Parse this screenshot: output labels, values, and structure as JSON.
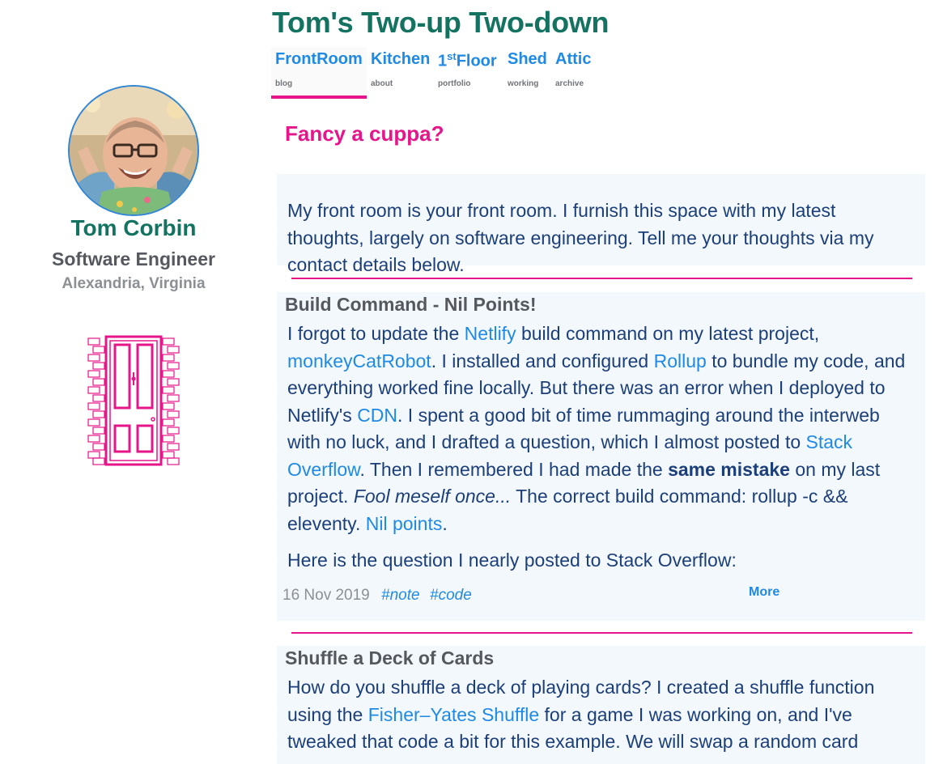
{
  "header": {
    "site_title": "Tom's Two-up Two-down",
    "nav": [
      {
        "label": "FrontRoom",
        "sub": "blog",
        "active": true
      },
      {
        "label": "Kitchen",
        "sub": "about"
      },
      {
        "label_prefix": "1",
        "label_sup": "st",
        "label_suffix": "Floor",
        "sub": "portfolio"
      },
      {
        "label": "Shed",
        "sub": "working"
      },
      {
        "label": "Attic",
        "sub": "archive"
      }
    ]
  },
  "sidebar": {
    "name": "Tom Corbin",
    "role": "Software Engineer",
    "location": "Alexandria, Virginia"
  },
  "main": {
    "heading": "Fancy a cuppa?",
    "intro": "My front room is your front room. I furnish this space with my latest thoughts, largely on software engineering. Tell me your thoughts via my contact details below.",
    "posts": [
      {
        "title": "Build Command - Nil Points!",
        "p1": {
          "t1": "I forgot to update the ",
          "link_netlify": "Netlify",
          "t2": " build command on my latest project, ",
          "link_project": "monkeyCatRobot",
          "t3": ". I installed and configured ",
          "link_rollup": "Rollup",
          "t4": " to bundle my code, and everything worked fine locally. But there was an error when I deployed to Netlify's ",
          "link_cdn": "CDN",
          "t5": ". I spent a good bit of time rummaging around the interweb with no luck, and I drafted a question, which I almost posted to ",
          "link_so": "Stack Overflow",
          "t6": ". Then I remembered I had made the ",
          "bold": "same mistake",
          "t7": " on my last project. ",
          "italic": "Fool meself once...",
          "t8": " The correct build command: rollup -c && eleventy. ",
          "link_nil": "Nil points",
          "t9": "."
        },
        "p2": "Here is the question I nearly posted to Stack Overflow:",
        "date": "16 Nov 2019",
        "tags": [
          "#note",
          "#code"
        ],
        "more": "More"
      },
      {
        "title": "Shuffle a Deck of Cards",
        "p1": {
          "t1": "How do you shuffle a deck of playing cards? I created a shuffle function using the ",
          "link_fy": "Fisher–Yates Shuffle",
          "t2": " for a game I was working on, and I've tweaked that code a bit for this example. We will swap a random card"
        }
      }
    ]
  },
  "colors": {
    "title_green": "#137360",
    "accent_pink": "#e6168a",
    "link_blue": "#1f8ae6",
    "body_navy": "#1c3f7a",
    "card_bg": "#f3f8fc"
  }
}
